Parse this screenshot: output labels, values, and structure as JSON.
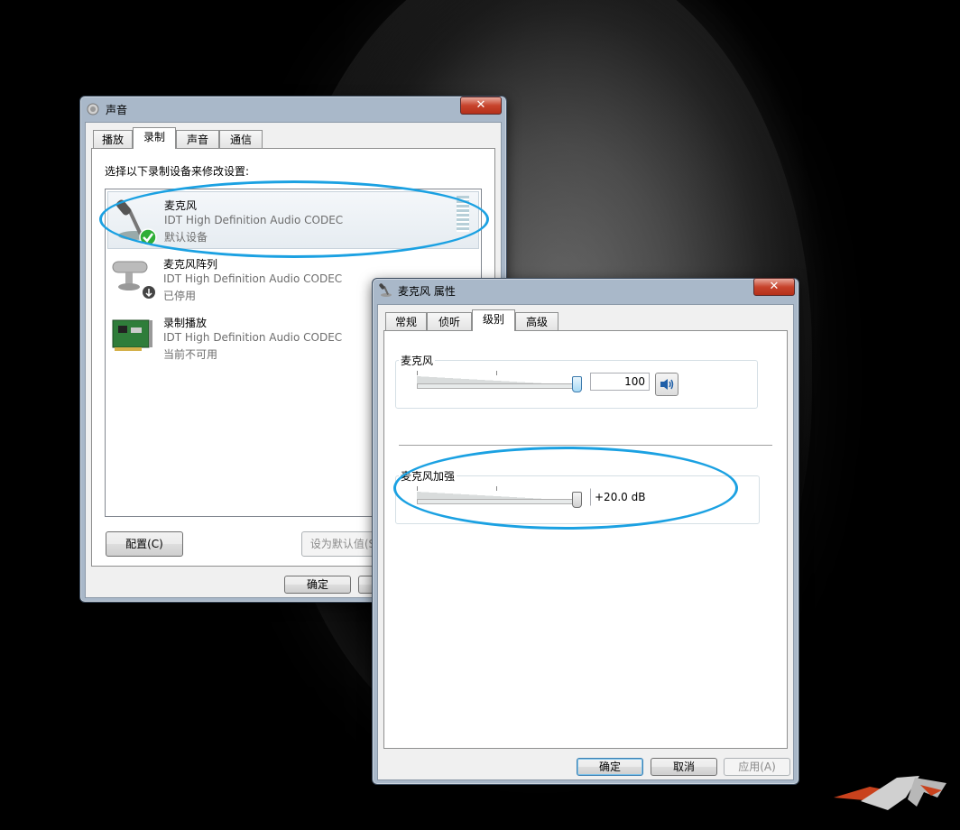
{
  "sound_dialog": {
    "title": "声音",
    "tabs": [
      "播放",
      "录制",
      "声音",
      "通信"
    ],
    "active_tab": "录制",
    "instruction": "选择以下录制设备来修改设置:",
    "devices": [
      {
        "name": "麦克风",
        "driver": "IDT High Definition Audio CODEC",
        "status": "默认设备",
        "icon": "microphone-icon"
      },
      {
        "name": "麦克风阵列",
        "driver": "IDT High Definition Audio CODEC",
        "status": "已停用",
        "icon": "webcam-mic-array-icon"
      },
      {
        "name": "录制播放",
        "driver": "IDT High Definition Audio CODEC",
        "status": "当前不可用",
        "icon": "sound-card-icon"
      }
    ],
    "configure_button": "配置(C)",
    "set_default_button": "设为默认值(S",
    "ok_button": "确定"
  },
  "props_dialog": {
    "title": "麦克风 属性",
    "tabs": [
      "常规",
      "侦听",
      "级别",
      "高级"
    ],
    "active_tab": "级别",
    "microphone_group": {
      "label": "麦克风",
      "value": "100",
      "level": 1.0
    },
    "boost_group": {
      "label": "麦克风加强",
      "value": "+20.0 dB",
      "level": 1.0
    },
    "ok_button": "确定",
    "cancel_button": "取消",
    "apply_button": "应用(A)"
  },
  "colors": {
    "callout": "#1ba1e2",
    "accent": "#3c7fb1"
  }
}
